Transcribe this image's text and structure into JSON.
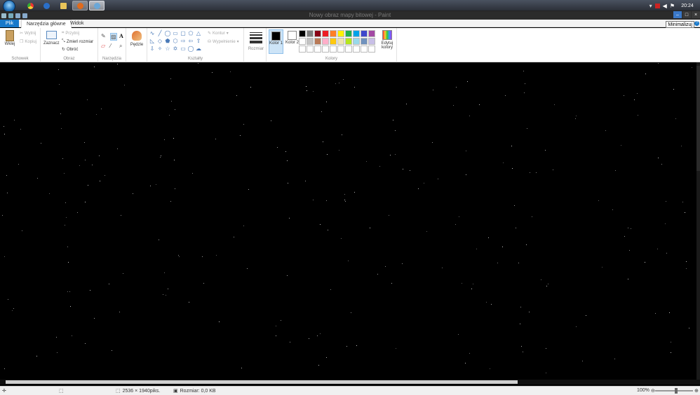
{
  "window": {
    "title": "Nowy obraz mapy bitowej - Paint",
    "tooltip": "Minimalizuj"
  },
  "clock": "20:24",
  "tabs": {
    "file": "Plik",
    "home": "Narzędzia główne",
    "view": "Widok"
  },
  "ribbon": {
    "clipboard": {
      "paste": "Wklej",
      "cut": "Wytnij",
      "copy": "Kopiuj",
      "label": "Schowek"
    },
    "image": {
      "select": "Zaznacz",
      "crop": "Przytnij",
      "resize": "Zmień rozmiar",
      "rotate": "Obróć",
      "label": "Obraz"
    },
    "tools": {
      "label": "Narzędzia"
    },
    "brushes": {
      "label": "Pędzle"
    },
    "shapes": {
      "outline": "Kontur",
      "fill": "Wypełnienie",
      "label": "Kształty"
    },
    "size": {
      "label": "Rozmiar"
    },
    "colors": {
      "color1": "Kolor 1",
      "color2": "Kolor 2",
      "edit": "Edytuj kolory",
      "label": "Kolory",
      "color1_value": "#000000",
      "color2_value": "#ffffff",
      "palette": [
        "#000000",
        "#7f7f7f",
        "#880015",
        "#ed1c24",
        "#ff7f27",
        "#fff200",
        "#22b14c",
        "#00a2e8",
        "#3f48cc",
        "#a349a4",
        "#ffffff",
        "#c3c3c3",
        "#b97a57",
        "#ffaec9",
        "#ffc90e",
        "#efe4b0",
        "#b5e61d",
        "#99d9ea",
        "#7092be",
        "#c8bfe7",
        "#ffffff",
        "#ffffff",
        "#ffffff",
        "#ffffff",
        "#ffffff",
        "#ffffff",
        "#ffffff",
        "#ffffff",
        "#ffffff",
        "#ffffff"
      ]
    }
  },
  "status": {
    "dimensions": "2536 × 1940piks.",
    "size": "Rozmiar: 0,0 KB",
    "zoom": "100%"
  }
}
